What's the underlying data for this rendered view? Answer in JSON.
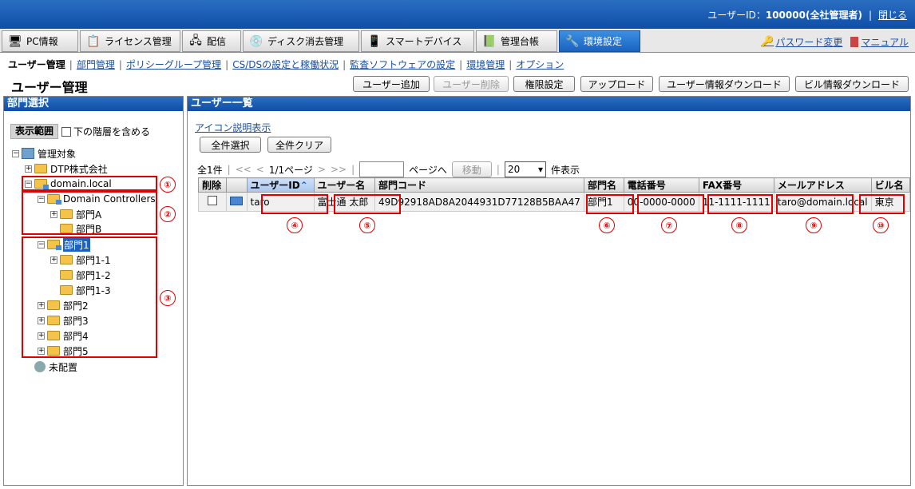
{
  "header": {
    "user_label": "ユーザーID：",
    "user_value": "100000(全社管理者)",
    "separator": "|",
    "logout": "閉じる"
  },
  "nav": {
    "tabs": [
      {
        "label": "PC情報",
        "icon": "pc-icon"
      },
      {
        "label": "ライセンス管理",
        "icon": "license-icon"
      },
      {
        "label": "配信",
        "icon": "distribution-icon"
      },
      {
        "label": "ディスク消去管理",
        "icon": "disk-icon"
      },
      {
        "label": "スマートデバイス",
        "icon": "smartphone-icon"
      },
      {
        "label": "管理台帳",
        "icon": "ledger-icon"
      },
      {
        "label": "環境設定",
        "icon": "tools-icon"
      }
    ],
    "password_change": "パスワード変更",
    "manual": "マニュアル"
  },
  "subnav": {
    "items": [
      "ユーザー管理",
      "部門管理",
      "ポリシーグループ管理",
      "CS/DSの設定と稼働状況",
      "監査ソフトウェアの設定",
      "環境管理",
      "オプション"
    ],
    "separator": "|"
  },
  "page": {
    "title": "ユーザー管理"
  },
  "toolbar": {
    "add_user": "ユーザー追加",
    "delete_user": "ユーザー削除",
    "permissions": "権限設定",
    "upload": "アップロード",
    "user_download": "ユーザー情報ダウンロード",
    "building_download": "ビル情報ダウンロード"
  },
  "left": {
    "title": "部門選択",
    "scope_label": "表示範囲",
    "include_sub": "下の階層を含める",
    "tree": {
      "root": "管理対象",
      "dtp": "DTP株式会社",
      "domain": "domain.local",
      "dc": "Domain Controllers",
      "deptA": "部門A",
      "deptB": "部門B",
      "dept1": "部門1",
      "dept1_1": "部門1-1",
      "dept1_2": "部門1-2",
      "dept1_3": "部門1-3",
      "dept2": "部門2",
      "dept3": "部門3",
      "dept4": "部門4",
      "dept5": "部門5",
      "unassigned": "未配置"
    },
    "markers": [
      "①",
      "②",
      "③"
    ]
  },
  "right": {
    "title": "ユーザー一覧",
    "icon_help": "アイコン説明表示",
    "select_all": "全件選択",
    "clear_all": "全件クリア",
    "pager": {
      "total": "全1件",
      "first": "<<",
      "prev": "<",
      "page": "1/1ページ",
      "next": ">",
      "last": ">>",
      "goto_suffix": "ページへ",
      "move": "移動",
      "per_page": "20",
      "per_page_suffix": "件表示"
    },
    "columns": {
      "delete": "削除",
      "user_id": "ユーザーID",
      "user_name": "ユーザー名",
      "dept_code": "部門コード",
      "dept_name": "部門名",
      "phone": "電話番号",
      "fax": "FAX番号",
      "email": "メールアドレス",
      "building": "ビル名"
    },
    "row": {
      "user_id": "taro",
      "user_name": "富士通 太郎",
      "dept_code": "49D92918AD8A2044931D77128B5BAA47",
      "dept_name": "部門1",
      "phone": "00-0000-0000",
      "fax": "11-1111-1111",
      "email": "taro@domain.local",
      "building": "東京"
    },
    "markers": [
      "④",
      "⑤",
      "⑥",
      "⑦",
      "⑧",
      "⑨",
      "⑩"
    ]
  }
}
